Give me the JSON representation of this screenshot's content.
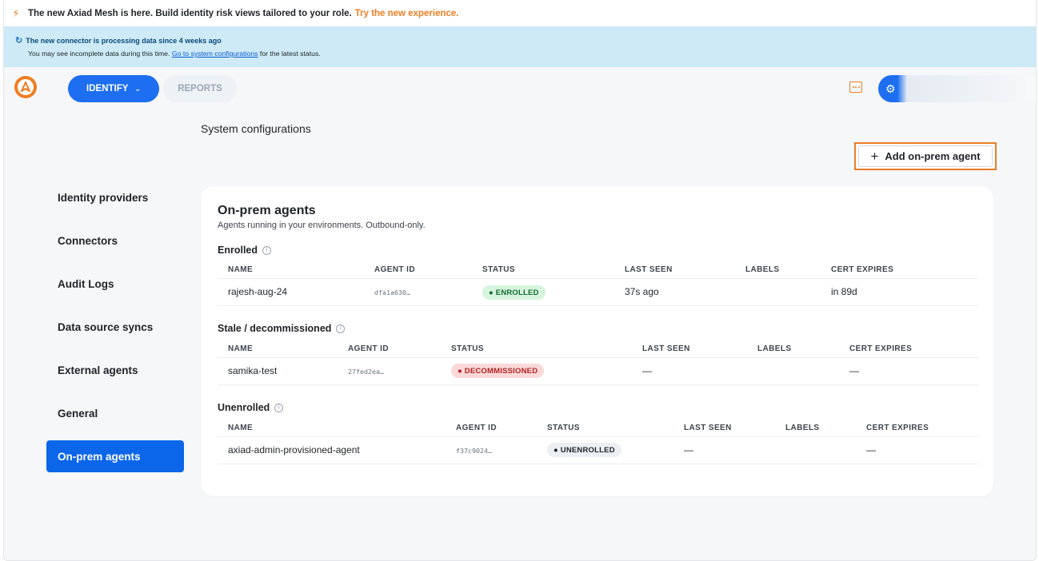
{
  "announcement": {
    "icon": "bolt-icon",
    "text": "The new Axiad Mesh is here. Build identity risk views tailored to your role.",
    "link": "Try the new experience."
  },
  "banner": {
    "title": "The new connector is processing data since 4 weeks ago",
    "text_before": "You may see incomplete data during this time.",
    "link": "Go to system configurations",
    "text_after": "for the latest status."
  },
  "nav": {
    "identify": "IDENTIFY",
    "reports": "REPORTS"
  },
  "page": {
    "title": "System configurations",
    "add_button": "Add on-prem agent"
  },
  "sidebar": {
    "items": [
      {
        "label": "Identity providers"
      },
      {
        "label": "Connectors"
      },
      {
        "label": "Audit Logs"
      },
      {
        "label": "Data source syncs"
      },
      {
        "label": "External agents"
      },
      {
        "label": "General"
      },
      {
        "label": "On-prem agents",
        "active": true
      }
    ]
  },
  "card": {
    "title": "On-prem agents",
    "subtitle": "Agents running in your environments. Outbound-only.",
    "columns": [
      "NAME",
      "AGENT ID",
      "STATUS",
      "LAST SEEN",
      "LABELS",
      "CERT EXPIRES"
    ],
    "sections": [
      {
        "title": "Enrolled",
        "rows": [
          {
            "name": "rajesh-aug-24",
            "agent_id": "dfa1a630…",
            "status": "● ENROLLED",
            "last_seen": "37s ago",
            "labels": "",
            "cert_expires": "in 89d"
          }
        ]
      },
      {
        "title": "Stale / decommissioned",
        "rows": [
          {
            "name": "samika-test",
            "agent_id": "27fed2ea…",
            "status": "● DECOMMISSIONED",
            "last_seen": "—",
            "labels": "",
            "cert_expires": "—"
          }
        ]
      },
      {
        "title": "Unenrolled",
        "rows": [
          {
            "name": "axiad-admin-provisioned-agent",
            "agent_id": "f37c9024…",
            "status": "● UNENROLLED",
            "last_seen": "—",
            "labels": "",
            "cert_expires": "—"
          }
        ]
      }
    ]
  },
  "colors": {
    "accent": "#1d6ef0",
    "brand_orange": "#f07d22",
    "banner_bg": "#cdeaf6",
    "enrolled_bg": "#d6f4de",
    "decommissioned_bg": "#fbd9d9",
    "unenrolled_bg": "#eceff3"
  }
}
